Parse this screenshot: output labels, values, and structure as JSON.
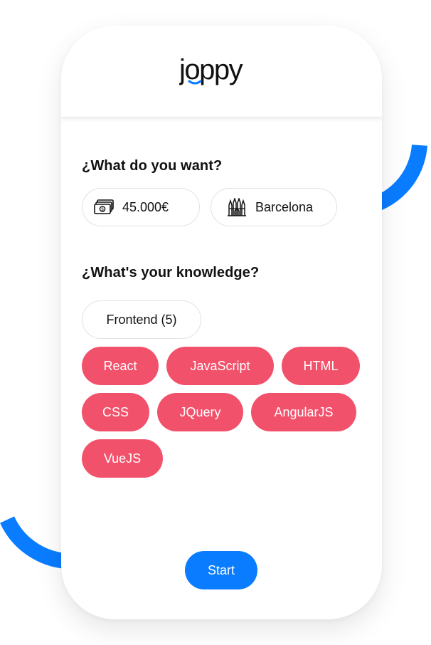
{
  "brand": {
    "name": "joppy",
    "accent": "#0a7cff"
  },
  "want": {
    "title": "¿What do you want?",
    "salary": {
      "value": "45.000€",
      "icon": "money-icon"
    },
    "city": {
      "value": "Barcelona",
      "icon": "cathedral-icon"
    }
  },
  "knowledge": {
    "title": "¿What's your knowledge?",
    "category": "Frontend (5)",
    "tags": [
      "React",
      "JavaScript",
      "HTML",
      "CSS",
      "JQuery",
      "AngularJS",
      "VueJS"
    ],
    "tag_color": "#f2516b"
  },
  "actions": {
    "start_label": "Start",
    "start_color": "#0a7cff"
  }
}
